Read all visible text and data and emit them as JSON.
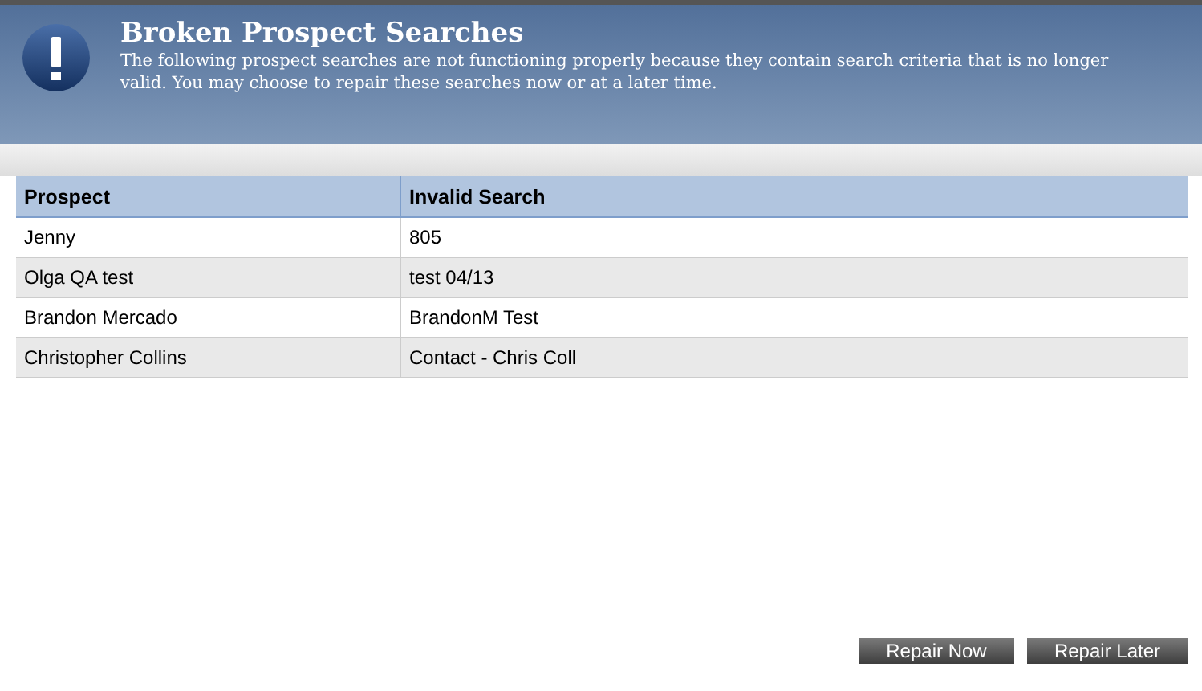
{
  "header": {
    "title": "Broken Prospect Searches",
    "message": "The following prospect searches are not functioning properly because they contain search criteria that is no longer valid. You may choose to repair these searches now or at a later time."
  },
  "table": {
    "columns": [
      "Prospect",
      "Invalid Search"
    ],
    "rows": [
      [
        "Jenny",
        "805"
      ],
      [
        "Olga QA test",
        "test 04/13"
      ],
      [
        "Brandon Mercado",
        "BrandonM Test"
      ],
      [
        "Christopher Collins",
        "Contact - Chris Coll"
      ]
    ]
  },
  "buttons": [
    "Repair Now",
    "Repair Later"
  ]
}
